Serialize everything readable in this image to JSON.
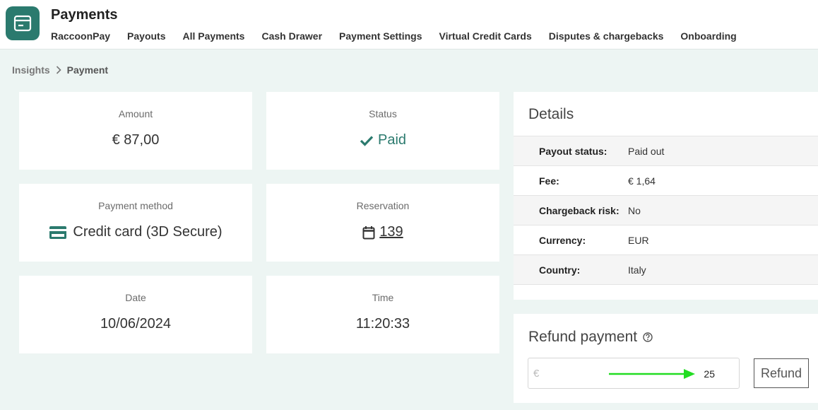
{
  "app": {
    "title": "Payments",
    "icon": "payment-terminal-icon"
  },
  "nav": [
    "RaccoonPay",
    "Payouts",
    "All Payments",
    "Cash Drawer",
    "Payment Settings",
    "Virtual Credit Cards",
    "Disputes & chargebacks",
    "Onboarding"
  ],
  "breadcrumb": {
    "parent": "Insights",
    "current": "Payment"
  },
  "cards": {
    "amount": {
      "label": "Amount",
      "value": "€ 87,00"
    },
    "status": {
      "label": "Status",
      "value": "Paid",
      "icon": "check-icon"
    },
    "method": {
      "label": "Payment method",
      "value": "Credit card (3D Secure)",
      "icon": "credit-card-icon"
    },
    "reservation": {
      "label": "Reservation",
      "value": "139",
      "icon": "calendar-icon"
    },
    "date": {
      "label": "Date",
      "value": "10/06/2024"
    },
    "time": {
      "label": "Time",
      "value": "11:20:33"
    }
  },
  "details": {
    "title": "Details",
    "rows": [
      {
        "label": "Payout status:",
        "value": "Paid out"
      },
      {
        "label": "Fee:",
        "value": "€ 1,64"
      },
      {
        "label": "Chargeback risk:",
        "value": "No"
      },
      {
        "label": "Currency:",
        "value": "EUR"
      },
      {
        "label": "Country:",
        "value": "Italy"
      }
    ]
  },
  "refund": {
    "title": "Refund payment",
    "currency_symbol": "€",
    "amount": "25",
    "button": "Refund"
  },
  "colors": {
    "brand": "#2b7a6e",
    "annotation_arrow": "#22dd22",
    "background": "#edf5f3"
  }
}
